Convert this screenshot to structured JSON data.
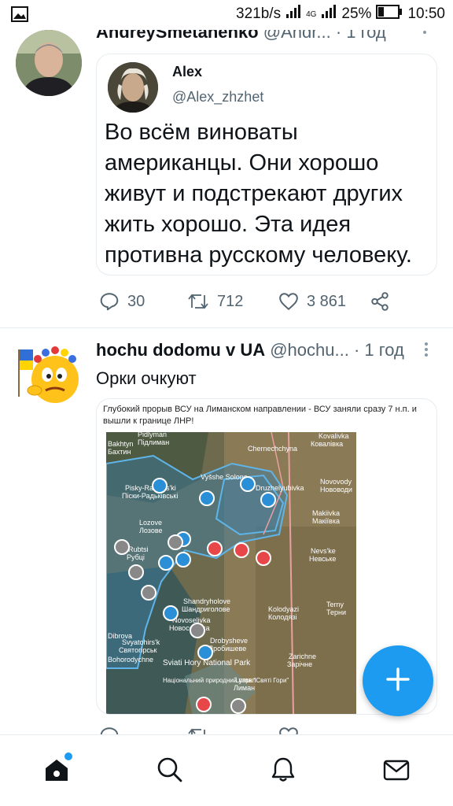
{
  "status_bar": {
    "speed": "321b/s",
    "network": "4G",
    "battery": "25%",
    "time": "10:50"
  },
  "tweet1": {
    "author_name": "AndreySmetanenko",
    "author_handle": "@Andr...",
    "time": "· 1 год",
    "quote": {
      "name": "Alex",
      "handle": "@Alex_zhzhet",
      "text": "Во всём виноваты американцы. Они хорошо живут и подстрекают других жить хорошо. Эта идея противна русскому человеку."
    },
    "replies": "30",
    "retweets": "712",
    "likes": "3 861"
  },
  "tweet2": {
    "author_name": "hochu dodomu v UA",
    "author_handle": "@hochu...",
    "time": "· 1 год",
    "text": "Орки очкуют",
    "media_caption": "Глубокий прорыв ВСУ на Лиманском направлении - ВСУ заняли сразу 7 н.п. и вышли к границе ЛНР!",
    "map_labels": {
      "pidlyman": "Pidlyman",
      "pidlyman_ua": "Підлиман",
      "bakhtyn": "Bakhtyn",
      "bakhtyn_ua": "Бахтин",
      "cherneshchyna": "Chernechchyna",
      "kovalivka": "Kovalivka",
      "kovalivka_ua": "Ковалівка",
      "pisky": "Pisky-Radkivs'ki",
      "pisky_ua": "Піски-Радьківські",
      "vysshe": "Vyšshe Solone",
      "novovody": "Novovody",
      "novovody_ua": "Нововоди",
      "druzhelyubivka": "Druzhelyubivka",
      "makiivka": "Makiivka",
      "makiivka_ua": "Макіївка",
      "lozove": "Lozove",
      "lozove_ua": "Лозове",
      "rubtsi": "Rubtsi",
      "rubtsi_ua": "Рубці",
      "nevske": "Nevs'ke",
      "nevske_ua": "Невське",
      "shandryholove": "Shandryholove",
      "shandryholove_ua": "Шандриголове",
      "kolodyazi": "Kolodyazi",
      "kolodyazi_ua": "Колодязі",
      "terny": "Terny",
      "terny_ua": "Терни",
      "novoselivka": "Novoselivka",
      "novoselivka_ua": "Новоселівка",
      "svyatohirsk": "Svyatohirs'k",
      "svyatohirsk_ua": "Святогірськ",
      "dibrova": "Dibrova",
      "drobysheve": "Drobysheve",
      "drobysheve_ua": "Дробишеве",
      "zarichne": "Zarichne",
      "zarichne_ua": "Зарічне",
      "bohorodychne": "Bohorodychne",
      "park": "Sviati Hory National Park",
      "park_ua": "Національний природний парк \"Святі Гори\"",
      "lyman": "Lyman",
      "lyman_ua": "Лиман"
    }
  }
}
